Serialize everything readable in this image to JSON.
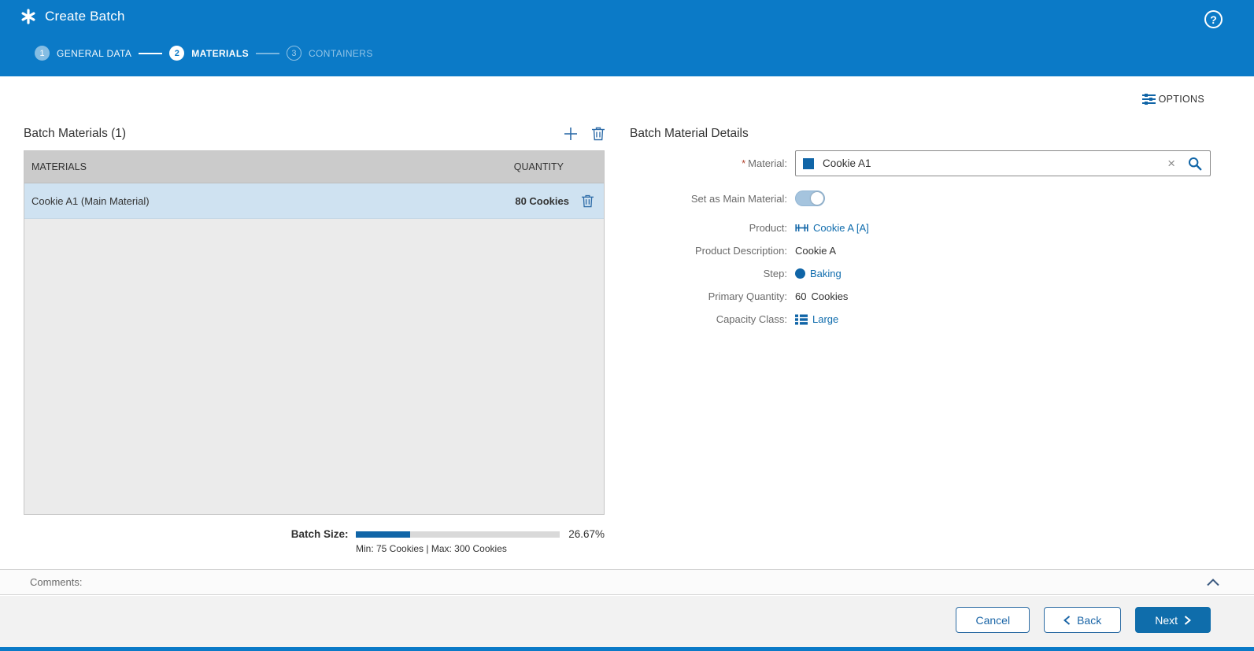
{
  "header": {
    "title": "Create Batch",
    "help_icon": "?",
    "steps": [
      {
        "number": "1",
        "label": "GENERAL DATA",
        "state": "completed"
      },
      {
        "number": "2",
        "label": "MATERIALS",
        "state": "active"
      },
      {
        "number": "3",
        "label": "CONTAINERS",
        "state": "upcoming"
      }
    ]
  },
  "toolbar": {
    "options_label": "OPTIONS"
  },
  "materials_panel": {
    "title": "Batch Materials (1)",
    "table": {
      "columns": {
        "materials": "MATERIALS",
        "quantity": "QUANTITY"
      },
      "rows": [
        {
          "material": "Cookie A1 (Main Material)",
          "quantity": "80 Cookies",
          "selected": true
        }
      ]
    },
    "batch_size": {
      "label": "Batch Size:",
      "percent": "26.67%",
      "percent_value": 26.67,
      "range": "Min: 75 Cookies | Max: 300 Cookies"
    }
  },
  "details_panel": {
    "title": "Batch Material Details",
    "material": {
      "required_mark": "*",
      "label": "Material:",
      "value": "Cookie A1",
      "clear_icon": "×"
    },
    "set_main": {
      "label": "Set as Main Material:",
      "state": "on"
    },
    "product": {
      "label": "Product:",
      "value": "Cookie A [A]"
    },
    "product_description": {
      "label": "Product Description:",
      "value": "Cookie A"
    },
    "step": {
      "label": "Step:",
      "value": "Baking"
    },
    "primary_quantity": {
      "label": "Primary Quantity:",
      "value": "60",
      "unit": "Cookies"
    },
    "capacity_class": {
      "label": "Capacity Class:",
      "value": "Large"
    }
  },
  "comments": {
    "label": "Comments:"
  },
  "footer": {
    "cancel_label": "Cancel",
    "back_label": "Back",
    "next_label": "Next"
  },
  "colors": {
    "header_blue": "#0b7ac7",
    "accent_blue": "#0f6cad",
    "progress_fill": "#1065a7",
    "selected_row": "#cfe2f1"
  }
}
